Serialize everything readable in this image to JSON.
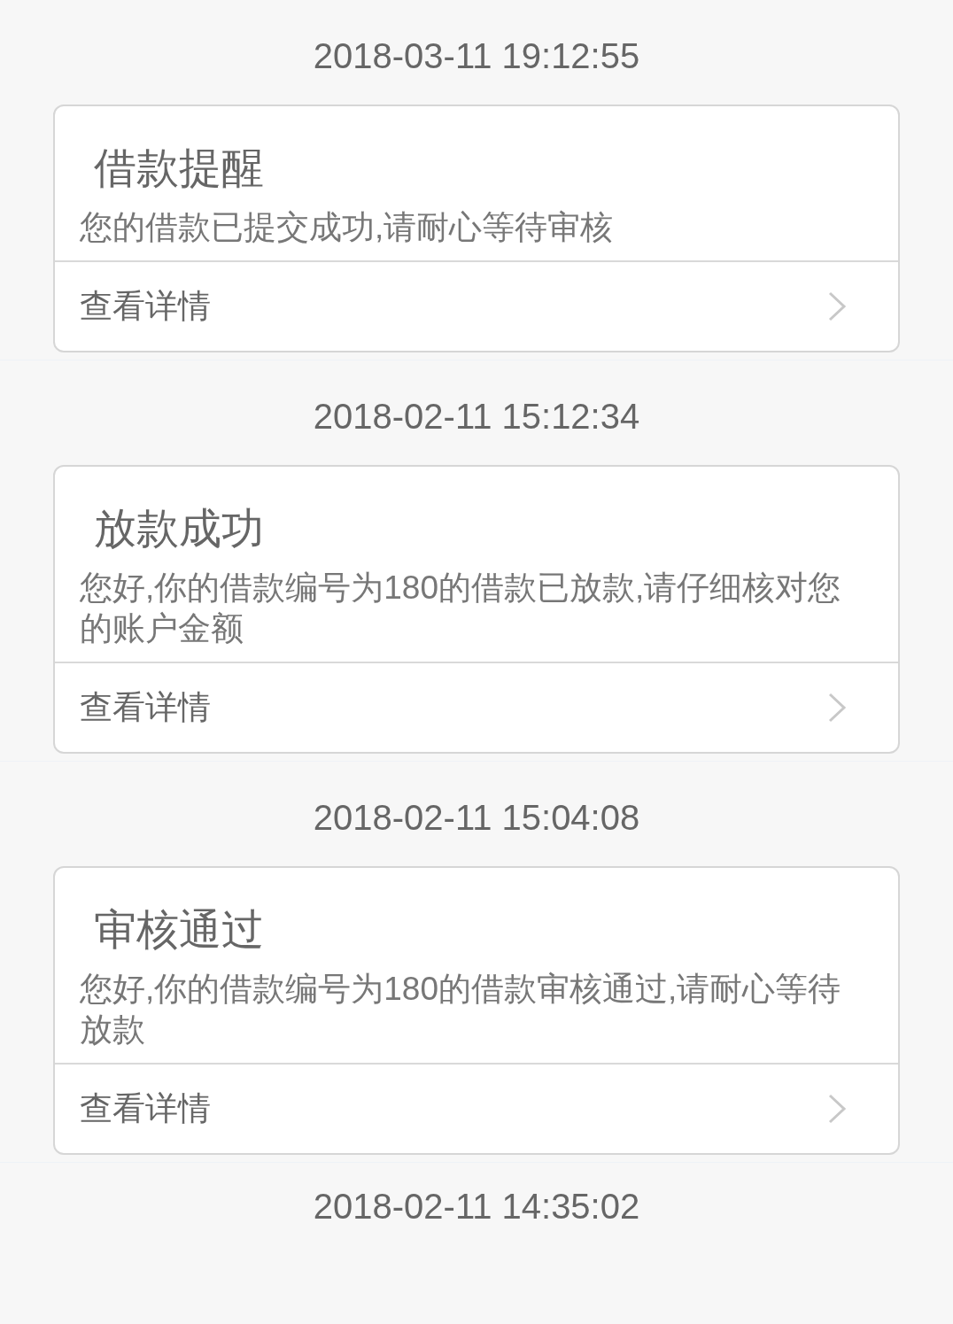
{
  "messages": [
    {
      "time": "2018-03-11 19:12:55",
      "title": "借款提醒",
      "body": "您的借款已提交成功,请耐心等待审核",
      "link": "查看详情"
    },
    {
      "time": "2018-02-11 15:12:34",
      "title": "放款成功",
      "body": "您好,你的借款编号为180的借款已放款,请仔细核对您的账户金额",
      "link": "查看详情"
    },
    {
      "time": "2018-02-11 15:04:08",
      "title": "审核通过",
      "body": "您好,你的借款编号为180的借款审核通过,请耐心等待放款",
      "link": "查看详情"
    }
  ],
  "next_time": "2018-02-11 14:35:02"
}
